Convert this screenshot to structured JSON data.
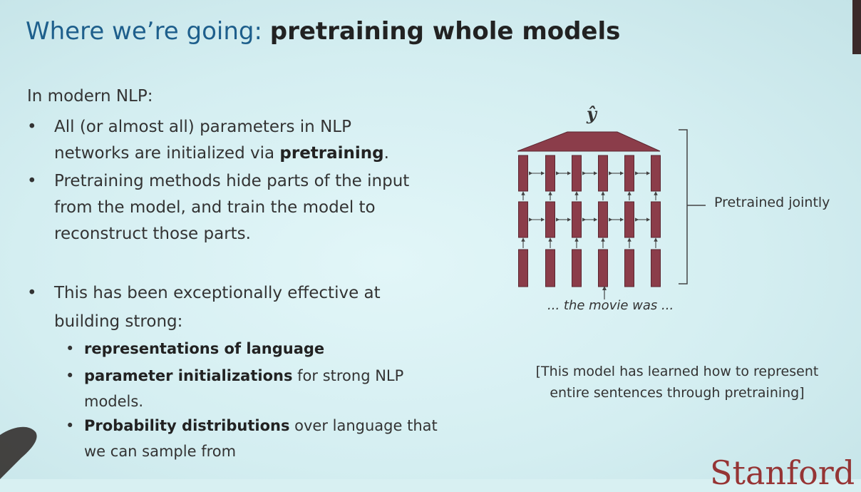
{
  "title": {
    "prefix": "Where we’re going: ",
    "bold": "pretraining whole models"
  },
  "intro": "In modern NLP:",
  "bullets": [
    {
      "line1_pre": "All (or almost all) parameters in NLP",
      "line2_pre": "networks are initialized via ",
      "line2_bold": "pretraining",
      "line2_post": "."
    },
    {
      "line1": "Pretraining methods hide parts of the input",
      "line2": "from the model, and train the model to",
      "line3": "reconstruct those parts."
    },
    {
      "line1": "This has been exceptionally effective at",
      "line2": "building strong:"
    }
  ],
  "subbullets": [
    {
      "bold": "representations of language",
      "rest": ""
    },
    {
      "bold": "parameter initializations",
      "rest": " for strong NLP",
      "line2": "models."
    },
    {
      "bold": "Probability distributions",
      "rest": " over language that",
      "line2": "we can sample from"
    }
  ],
  "diagram": {
    "output_label": "ŷ",
    "bracket_label": "Pretrained jointly",
    "input_label": "... the movie was ...",
    "colors": {
      "cell": "#8b3d4a",
      "cell_border": "#5b2630",
      "arrow": "#444444"
    }
  },
  "caption": {
    "line1": "[This model has learned how to represent",
    "line2": "entire sentences through pretraining]"
  },
  "logo": "Stanford"
}
